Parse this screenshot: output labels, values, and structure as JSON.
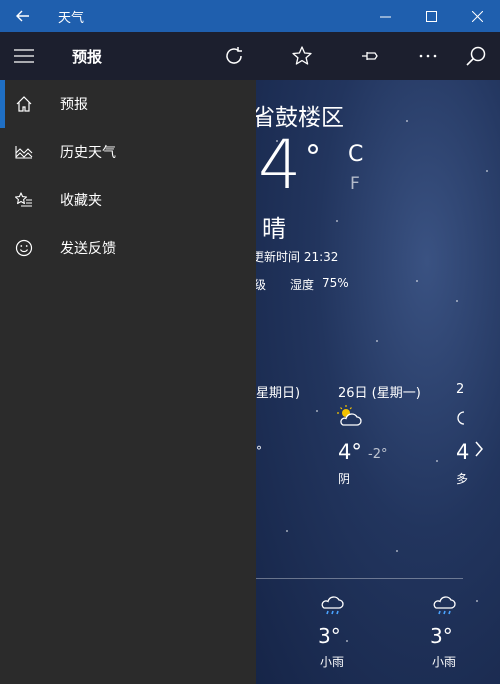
{
  "window": {
    "title": "天气"
  },
  "appbar": {
    "title": "预报"
  },
  "nav": {
    "items": [
      {
        "label": "预报",
        "icon": "home-icon"
      },
      {
        "label": "历史天气",
        "icon": "chart-icon"
      },
      {
        "label": "收藏夹",
        "icon": "favorites-list-icon"
      },
      {
        "label": "发送反馈",
        "icon": "smiley-icon"
      }
    ]
  },
  "current": {
    "location": "省鼓楼区",
    "temp": "4",
    "degree": "°",
    "unit_c": "C",
    "unit_f": "F",
    "condition": "晴",
    "updated": "更新时间 21:32",
    "detail_partial": "级",
    "humidity_label": "湿度",
    "humidity_value": "75%"
  },
  "forecast": {
    "day1_header": "星期日)",
    "day1_low": "°",
    "day2_header": "26日 (星期一)",
    "day2_high": "4°",
    "day2_low": "-2°",
    "day2_condition": "阴",
    "day3_header": "2",
    "day3_high": "4",
    "day3_condition": "多"
  },
  "hourly": [
    {
      "temp": "3°",
      "condition": "小雨"
    },
    {
      "temp": "3°",
      "condition": "小雨"
    }
  ]
}
